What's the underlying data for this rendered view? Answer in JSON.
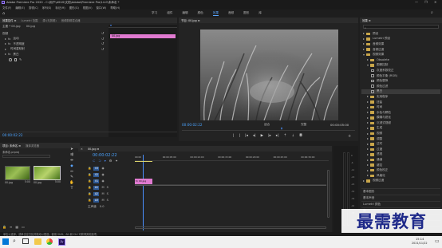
{
  "title_bar": {
    "title": "Adobe Premiere Pro 2020 - C:\\用户\\ASUS\\文档\\Adobe\\Premiere Pro\\14.0\\未命名 *",
    "controls": [
      "—",
      "❐",
      "✕"
    ]
  },
  "menu_bar": {
    "items": [
      "文件(F)",
      "编辑(E)",
      "剪辑(C)",
      "序列(S)",
      "标记(M)",
      "图形(G)",
      "视图(V)",
      "窗口(W)",
      "帮助(H)"
    ]
  },
  "workspaces": {
    "items": [
      "学习",
      "组件",
      "编辑",
      "颜色",
      "效果",
      "音频",
      "图形",
      "库"
    ],
    "active_index": 4
  },
  "effect_controls": {
    "tabs": [
      "效果控件 ≡",
      "Lumetri 范围",
      "源:(无剪辑)",
      "音频剪辑混合器"
    ],
    "clip_label": "主要 * 00.jpg",
    "sequence_label": "00.jpg",
    "sections": [
      "视频",
      "运动",
      "不透明度",
      "时间重映射",
      "音频",
      "音量"
    ],
    "mini_clip": "00.jpg"
  },
  "program_monitor": {
    "title": "节目: 00.jpg ≡",
    "timecode_left": "00:00:02:22",
    "fit": "适合",
    "quality": "完整",
    "timecode_right": "00:00:05:00"
  },
  "project": {
    "tabs": [
      "项目: 未命名 ≡",
      "媒体浏览器"
    ],
    "file": "未命名.prproj",
    "items": [
      {
        "name": "00.jpg",
        "duration": "5:00"
      },
      {
        "name": "00.jpg",
        "duration": "5:00"
      }
    ]
  },
  "timeline": {
    "tab": "00.jpg ≡",
    "timecode": "00:00:02:22",
    "ruler": [
      "00:00",
      "00:00:05:00",
      "00:00:10:00",
      "00:00:15:00",
      "00:00:20:00",
      "00:00:25:00",
      "00:00:30:00"
    ],
    "video_tracks": [
      "V3",
      "V2",
      "V1"
    ],
    "audio_tracks": [
      "A1",
      "A2",
      "A3"
    ],
    "master": "主声道",
    "master_value": "0.0",
    "clip_label": "00.jpg"
  },
  "effects_panel": {
    "title": "效果 ≡",
    "items": [
      {
        "label": "预设",
        "level": 0,
        "type": "folder",
        "open": false
      },
      {
        "label": "Lumetri 预设",
        "level": 0,
        "type": "folder",
        "open": false
      },
      {
        "label": "音频效果",
        "level": 0,
        "type": "folder",
        "open": false
      },
      {
        "label": "音频过渡",
        "level": 0,
        "type": "folder",
        "open": false
      },
      {
        "label": "视频效果",
        "level": 0,
        "type": "folder",
        "open": true
      },
      {
        "label": "Obsolete",
        "level": 1,
        "type": "folder",
        "open": false
      },
      {
        "label": "图像控制",
        "level": 1,
        "type": "folder",
        "open": true
      },
      {
        "label": "灰度系数校正",
        "level": 2,
        "type": "fx"
      },
      {
        "label": "颜色平衡 (RGB)",
        "level": 2,
        "type": "fx"
      },
      {
        "label": "颜色替换",
        "level": 2,
        "type": "fx"
      },
      {
        "label": "颜色过滤",
        "level": 2,
        "type": "fx"
      },
      {
        "label": "黑白",
        "level": 2,
        "type": "fx",
        "selected": true
      },
      {
        "label": "实用程序",
        "level": 1,
        "type": "folder",
        "open": false
      },
      {
        "label": "扭曲",
        "level": 1,
        "type": "folder",
        "open": false
      },
      {
        "label": "时间",
        "level": 1,
        "type": "folder",
        "open": false
      },
      {
        "label": "杂色与颗粒",
        "level": 1,
        "type": "folder",
        "open": false
      },
      {
        "label": "模糊与锐化",
        "level": 1,
        "type": "folder",
        "open": false
      },
      {
        "label": "沉浸式视频",
        "level": 1,
        "type": "folder",
        "open": false
      },
      {
        "label": "生成",
        "level": 1,
        "type": "folder",
        "open": false
      },
      {
        "label": "视频",
        "level": 1,
        "type": "folder",
        "open": false
      },
      {
        "label": "调整",
        "level": 1,
        "type": "folder",
        "open": false
      },
      {
        "label": "过时",
        "level": 1,
        "type": "folder",
        "open": false
      },
      {
        "label": "过渡",
        "level": 1,
        "type": "folder",
        "open": false
      },
      {
        "label": "透视",
        "level": 1,
        "type": "folder",
        "open": false
      },
      {
        "label": "通道",
        "level": 1,
        "type": "folder",
        "open": false
      },
      {
        "label": "键控",
        "level": 1,
        "type": "folder",
        "open": false
      },
      {
        "label": "颜色校正",
        "level": 1,
        "type": "folder",
        "open": false
      },
      {
        "label": "风格化",
        "level": 1,
        "type": "folder",
        "open": false
      },
      {
        "label": "视频过渡",
        "level": 0,
        "type": "folder",
        "open": false
      }
    ],
    "sections": [
      "基本图形",
      "基本声音",
      "Lumetri 颜色",
      "库",
      "标记",
      "历史记录",
      "信息"
    ]
  },
  "status_bar": {
    "text": "单击以选择，或单击空白处并拖动以框选。使用 Shift、Alt 和 Ctrl 可获得其他选项。"
  },
  "taskbar": {
    "clock_time": "15:14",
    "clock_date": "2021/11/22"
  },
  "watermark": {
    "text": "最需教育"
  },
  "colors": {
    "accent": "#2d8cff",
    "clip": "#e07ad0",
    "watermark": "#1f2a8a",
    "folder": "#c9a64a"
  }
}
